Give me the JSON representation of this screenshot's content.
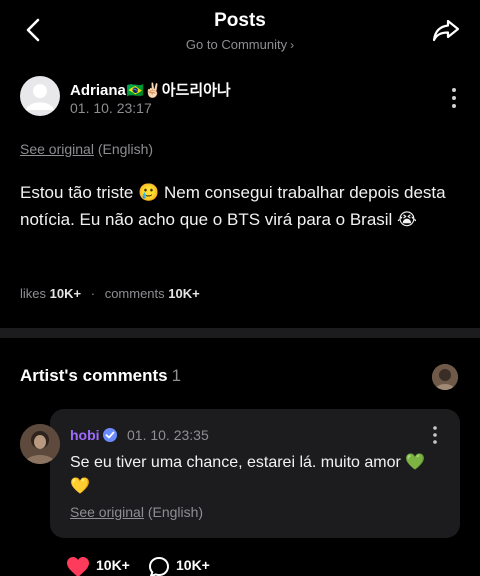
{
  "header": {
    "title": "Posts",
    "subtitle": "Go to Community",
    "back_icon": "chevron-left-icon",
    "share_icon": "share-arrow-icon"
  },
  "post": {
    "author_name": "Adriana",
    "author_emoji": "🇧🇷✌🏻",
    "author_name_korean": "아드리아나",
    "date": "01. 10. 23:17",
    "see_original_link": "See original",
    "see_original_lang": "(English)",
    "body": "Estou tão triste 🥲 Nem consegui trabalhar depois desta notícia. Eu não acho que o BTS virá para o Brasil 😭",
    "likes_label": "likes",
    "likes_count": "10K+",
    "comments_label": "comments",
    "comments_count": "10K+"
  },
  "artist_comments": {
    "title": "Artist's comments",
    "count": "1",
    "comment": {
      "author": "hobi",
      "date": "01. 10. 23:35",
      "text": "Se eu tiver uma chance, estarei lá. muito amor 💚💛",
      "see_original_link": "See original",
      "see_original_lang": "(English)",
      "likes_count": "10K+",
      "replies_count": "10K+"
    }
  },
  "colors": {
    "background": "#000000",
    "artist_name": "#9d6cff",
    "verified": "#6a8cff",
    "like_heart": "#ff3b5c",
    "muted": "#8e8e93",
    "card": "#1c1c1e"
  }
}
